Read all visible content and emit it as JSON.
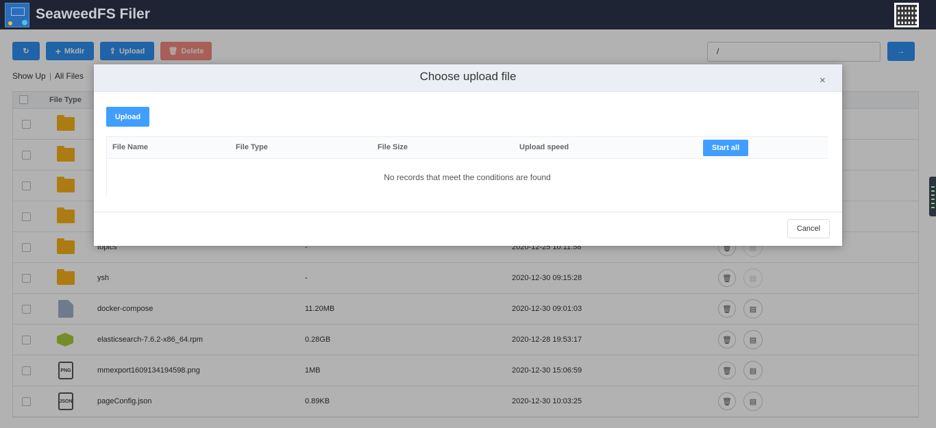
{
  "header": {
    "title": "SeaweedFS Filer",
    "logo_icon": "seaweedfs-logo",
    "qr_icon": "qr-code-icon",
    "bg_color": "#1e2433"
  },
  "toolbar": {
    "refresh_icon": "refresh-icon",
    "mkdir_label": "Mkdir",
    "upload_label": "Upload",
    "delete_label": "Delete",
    "path_value": "/",
    "go_icon": "arrow-right-icon",
    "accent_color": "#2f8ef0",
    "danger_color": "#f0887f"
  },
  "crumbs": {
    "show_up": "Show Up",
    "separator": "|",
    "all_files": "All Files"
  },
  "table": {
    "header_type": "File Type",
    "rows": [
      {
        "icon": "folder-icon",
        "name": "",
        "size": "",
        "date": ""
      },
      {
        "icon": "folder-icon",
        "name": "",
        "size": "",
        "date": ""
      },
      {
        "icon": "folder-icon",
        "name": "",
        "size": "",
        "date": ""
      },
      {
        "icon": "folder-icon",
        "name": "",
        "size": "",
        "date": ""
      },
      {
        "icon": "folder-icon",
        "name": "topics",
        "size": "-",
        "date": "2020-12-25 10:11:58"
      },
      {
        "icon": "folder-icon",
        "name": "ysh",
        "size": "-",
        "date": "2020-12-30 09:15:28"
      },
      {
        "icon": "cloud-file-icon",
        "name": "docker-compose",
        "size": "11.20MB",
        "date": "2020-12-30 09:01:03"
      },
      {
        "icon": "package-icon",
        "name": "elasticsearch-7.6.2-x86_64.rpm",
        "size": "0.28GB",
        "date": "2020-12-28 19:53:17"
      },
      {
        "icon": "png-file-icon",
        "icon_text": "PNG",
        "name": "mmexport1609134194598.png",
        "size": "1MB",
        "date": "2020-12-30 15:06:59"
      },
      {
        "icon": "json-file-icon",
        "icon_text": "JSON",
        "name": "pageConfig.json",
        "size": "0.89KB",
        "date": "2020-12-30 10:03:25"
      }
    ]
  },
  "modal": {
    "title": "Choose upload file",
    "close_glyph": "×",
    "upload_label": "Upload",
    "columns": {
      "file_name": "File Name",
      "file_type": "File Type",
      "file_size": "File Size",
      "upload_speed": "Upload speed"
    },
    "start_all_label": "Start all",
    "empty_text": "No records that meet the conditions are found",
    "cancel_label": "Cancel",
    "accent_color": "#409eff"
  }
}
